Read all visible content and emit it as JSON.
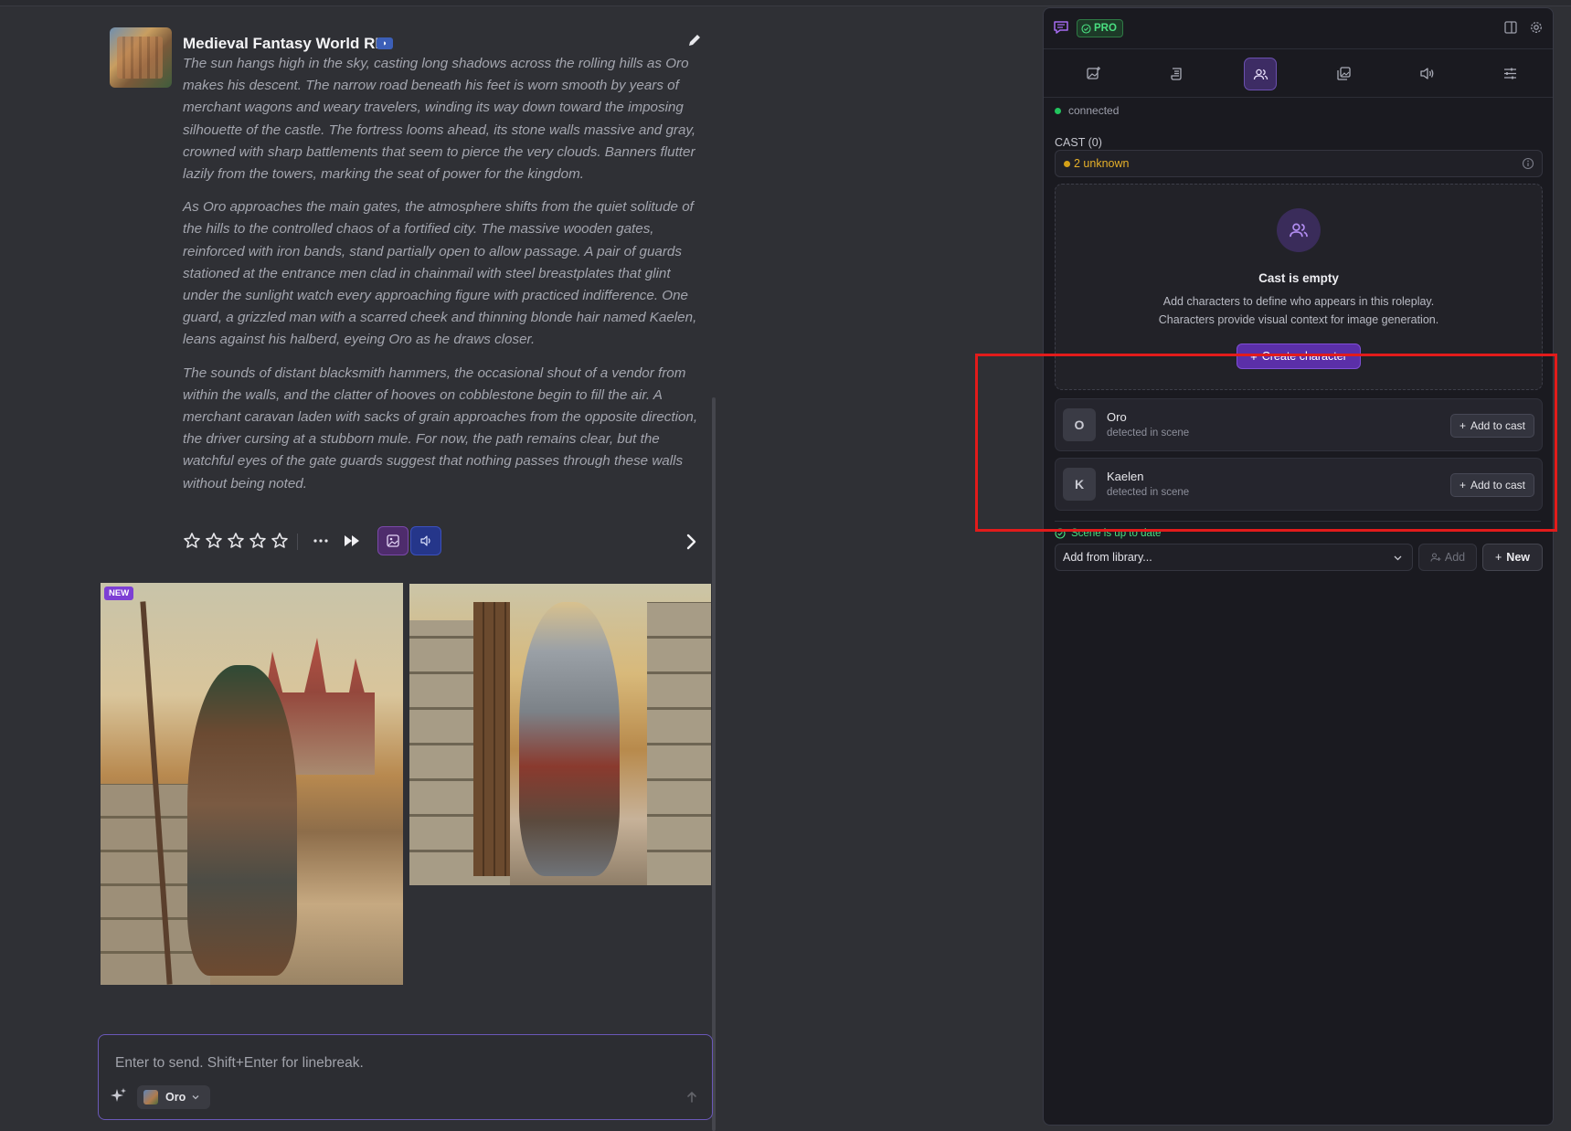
{
  "message": {
    "title": "Medieval Fantasy World RP",
    "title_badge_icon": "moon-badge",
    "paragraphs": [
      "The sun hangs high in the sky, casting long shadows across the rolling hills as Oro makes his descent. The narrow road beneath his feet is worn smooth by years of merchant wagons and weary travelers, winding its way down toward the imposing silhouette of the castle. The fortress looms ahead, its stone walls massive and gray, crowned with sharp battlements that seem to pierce the very clouds. Banners flutter lazily from the towers, marking the seat of power for the kingdom.",
      "As Oro approaches the main gates, the atmosphere shifts from the quiet solitude of the hills to the controlled chaos of a fortified city. The massive wooden gates, reinforced with iron bands, stand partially open to allow passage. A pair of guards stationed at the entrance men clad in chainmail with steel breastplates that glint under the sunlight watch every approaching figure with practiced indifference. One guard, a grizzled man with a scarred cheek and thinning blonde hair named Kaelen, leans against his halberd, eyeing Oro as he draws closer.",
      "The sounds of distant blacksmith hammers, the occasional shout of a vendor from within the walls, and the clatter of hooves on cobblestone begin to fill the air. A merchant caravan laden with sacks of grain approaches from the opposite direction, the driver cursing at a stubborn mule. For now, the path remains clear, but the watchful eyes of the gate guards suggest that nothing passes through these walls without being noted."
    ],
    "rating": {
      "stars_total": 5,
      "stars_filled": 0
    },
    "new_badge": "NEW"
  },
  "composer": {
    "placeholder": "Enter to send. Shift+Enter for linebreak.",
    "value": "",
    "character": "Oro"
  },
  "panel": {
    "pro_label": "PRO",
    "status": "connected",
    "cast_label": "CAST (0)",
    "unknown": "2 unknown",
    "empty": {
      "title": "Cast is empty",
      "desc1": "Add characters to define who appears in this roleplay.",
      "desc2": "Characters provide visual context for image generation.",
      "create_label": "Create character"
    },
    "candidates": [
      {
        "initial": "O",
        "name": "Oro",
        "sub": "detected in scene",
        "action": "Add to cast"
      },
      {
        "initial": "K",
        "name": "Kaelen",
        "sub": "detected in scene",
        "action": "Add to cast"
      }
    ],
    "scene_status": "Scene is up to date",
    "library_placeholder": "Add from library...",
    "add_label": "Add",
    "new_label": "New"
  },
  "colors": {
    "accent": "#7c3aed",
    "success": "#4ade80",
    "warning": "#e5b02a",
    "highlight": "#e21b1b"
  }
}
